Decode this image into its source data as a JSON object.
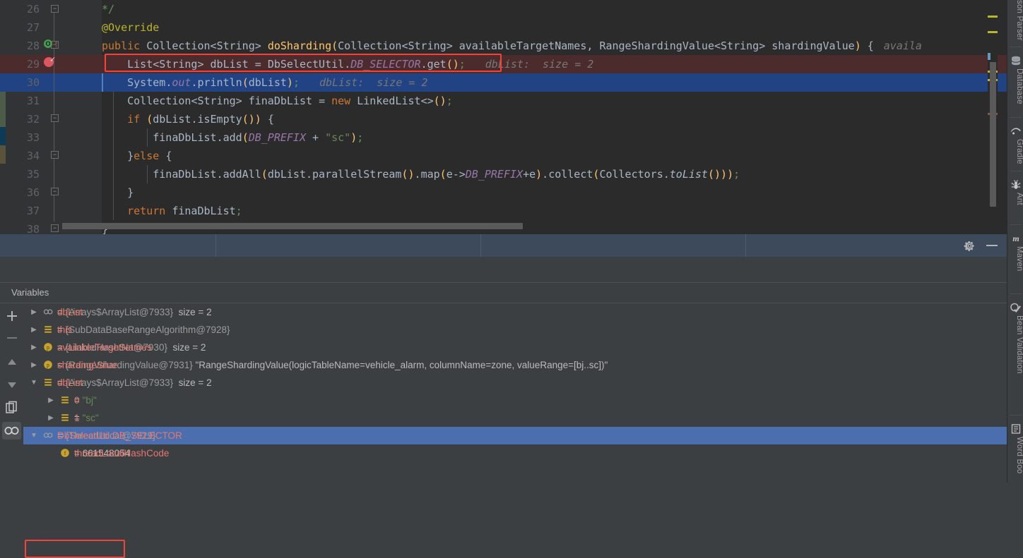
{
  "editor": {
    "lines": [
      {
        "num": "26",
        "text": "    */"
      },
      {
        "num": "27",
        "text": "    @Override"
      },
      {
        "num": "28",
        "text": "    public Collection<String> doSharding(Collection<String> availableTargetNames, RangeShardingValue<String> shardingValue) {"
      },
      {
        "num": "29",
        "text": "        List<String> dbList = DbSelectUtil.DB_SELECTOR.get();"
      },
      {
        "num": "30",
        "text": "        System.out.println(dbList);"
      },
      {
        "num": "31",
        "text": "        Collection<String> finaDbList = new LinkedList<>();"
      },
      {
        "num": "32",
        "text": "        if (dbList.isEmpty()) {"
      },
      {
        "num": "33",
        "text": "            finaDbList.add(DB_PREFIX + \"sc\");"
      },
      {
        "num": "34",
        "text": "        }else {"
      },
      {
        "num": "35",
        "text": "            finaDbList.addAll(dbList.parallelStream().map(e->DB_PREFIX+e).collect(Collectors.toList()));"
      },
      {
        "num": "36",
        "text": "        }"
      },
      {
        "num": "37",
        "text": "        return finaDbList;"
      },
      {
        "num": "38",
        "text": "    }"
      }
    ],
    "inline_hints": {
      "line28_tail": "availa",
      "line29_hint": "dbList:  size = 2",
      "line30_hint": "dbList:  size = 2"
    },
    "gutter_icons": {
      "override_marker": "override-implements-icon",
      "breakpoint": "breakpoint-verified-icon"
    },
    "highlight_color": "#f4433a"
  },
  "debug": {
    "toolbar_icons": [
      "mouse-cursor-icon",
      "table-view-icon",
      "sort-icon",
      "layout-settings-icon"
    ],
    "panel_buttons": {
      "settings": "gear-icon",
      "minimize": "minimize-icon"
    },
    "variables_header": "Variables",
    "rail_icons": [
      "add-watch-icon",
      "remove-watch-icon",
      "move-up-icon",
      "move-down-icon",
      "copy-icon",
      "watches-icon"
    ],
    "rows": [
      {
        "indent": 0,
        "twist": "collapsed",
        "icon": "oo",
        "name": "dbList",
        "ref": "{Arrays$ArrayList@7933}",
        "size": "size = 2",
        "value": "",
        "selected": false,
        "highlighted": false
      },
      {
        "indent": 0,
        "twist": "collapsed",
        "icon": "list",
        "name": "this",
        "ref": "{SubDataBaseRangeAlgorithm@7928}",
        "size": "",
        "value": "",
        "selected": false,
        "highlighted": false
      },
      {
        "indent": 0,
        "twist": "collapsed",
        "icon": "p",
        "name": "availableTargetNames",
        "ref": "{LinkedHashSet@7930}",
        "size": "size = 2",
        "value": "",
        "selected": false,
        "highlighted": false
      },
      {
        "indent": 0,
        "twist": "collapsed",
        "icon": "p",
        "name": "shardingValue",
        "ref": "{RangeShardingValue@7931}",
        "size": "",
        "value": "\"RangeShardingValue(logicTableName=vehicle_alarm, columnName=zone, valueRange=[bj..sc])\"",
        "selected": false,
        "highlighted": false
      },
      {
        "indent": 0,
        "twist": "expanded",
        "icon": "list",
        "name": "dbList",
        "ref": "{Arrays$ArrayList@7933}",
        "size": "size = 2",
        "value": "",
        "selected": false,
        "highlighted": true
      },
      {
        "indent": 1,
        "twist": "collapsed",
        "icon": "list",
        "name": "0",
        "ref": "",
        "size": "",
        "value": "\"bj\"",
        "selected": false,
        "highlighted": false
      },
      {
        "indent": 1,
        "twist": "collapsed",
        "icon": "list",
        "name": "1",
        "ref": "",
        "size": "",
        "value": "\"sc\"",
        "selected": false,
        "highlighted": false
      },
      {
        "indent": 0,
        "twist": "expanded",
        "icon": "oo",
        "name": "DbSelectUtil.DB_SELECTOR",
        "ref": "{ThreadLocal@7929}",
        "size": "",
        "value": "",
        "selected": true,
        "highlighted": false
      },
      {
        "indent": 1,
        "twist": "none",
        "icon": "f",
        "name": "threadLocalHashCode",
        "ref": "",
        "size": "",
        "value": "661548054",
        "selected": false,
        "highlighted": false
      }
    ]
  },
  "right_tool_strip": [
    {
      "label": "son Parser",
      "icon": ""
    },
    {
      "label": "Database",
      "icon": "database-icon"
    },
    {
      "label": "Gradle",
      "icon": "gradle-icon"
    },
    {
      "label": "Ant",
      "icon": "ant-icon"
    },
    {
      "label": "Maven",
      "icon": "maven-icon"
    },
    {
      "label": "Bean Validation",
      "icon": "bean-validation-icon"
    },
    {
      "label": "Word Boo",
      "icon": "word-book-icon"
    }
  ]
}
